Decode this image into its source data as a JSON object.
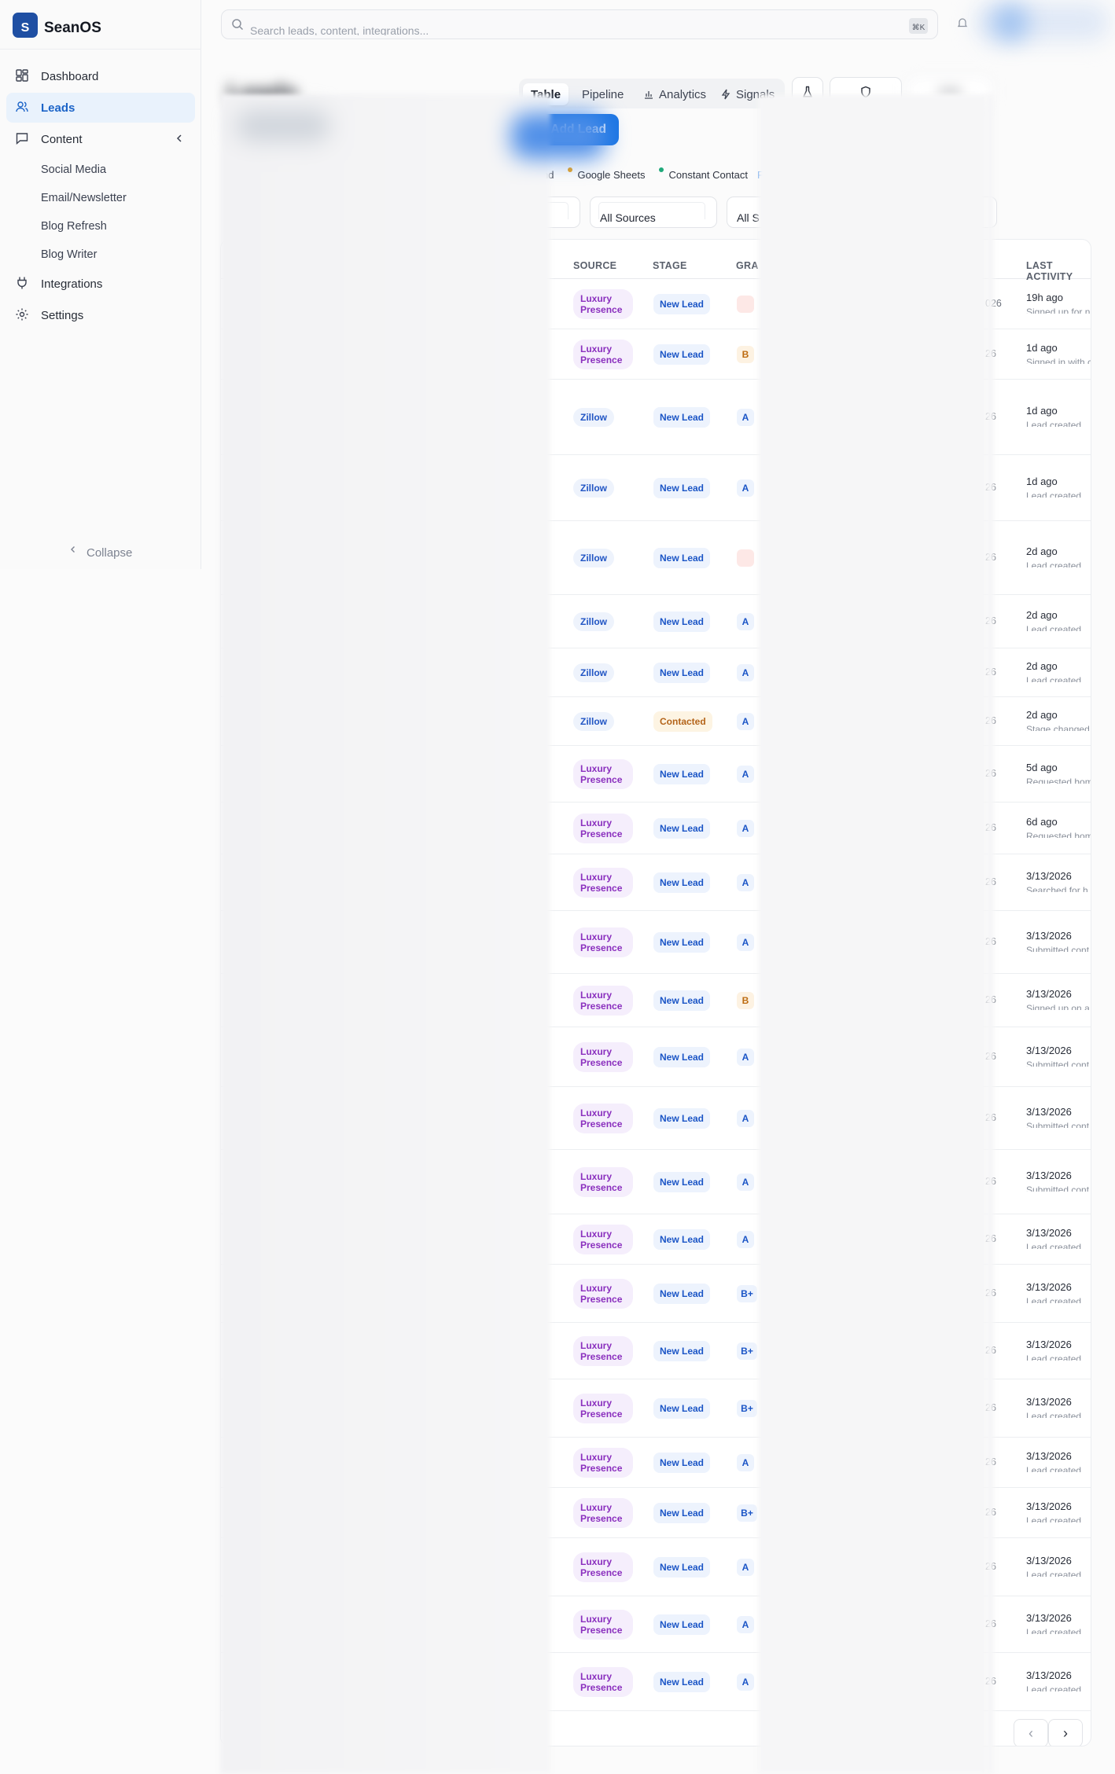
{
  "brand": {
    "mark": "S",
    "name": "SeanOS"
  },
  "nav": {
    "items": [
      {
        "label": "Dashboard"
      },
      {
        "label": "Leads"
      },
      {
        "label": "Content"
      },
      {
        "label": "Integrations"
      },
      {
        "label": "Settings"
      }
    ],
    "content_sub": [
      "Social Media",
      "Email/Newsletter",
      "Blog Refresh",
      "Blog Writer"
    ],
    "collapse_label": "Collapse"
  },
  "search": {
    "placeholder": "Search leads, content, integrations...",
    "shortcut": "⌘K"
  },
  "page": {
    "title": "Leads"
  },
  "tabs": {
    "table": "Table",
    "pipeline": "Pipeline",
    "analytics": "Analytics",
    "signals": "Signals"
  },
  "toolbar": {
    "add_lead": "Add Lead",
    "csv": "CSV"
  },
  "integrations_bar": {
    "lead_text": "nd",
    "google_sheets": "Google Sheets",
    "constant_contact": "Constant Contact",
    "link": "F"
  },
  "filters": {
    "sources": "All Sources",
    "stages": "All S"
  },
  "table": {
    "headers": {
      "source": "SOURCE",
      "stage": "STAGE",
      "grade": "GRA",
      "last_activity": "LAST ACTIVITY"
    },
    "rows": [
      {
        "source": "Luxury Presence",
        "stage": "New Lead",
        "grade": "",
        "date": "026",
        "when": "19h ago",
        "desc": "Signed up for n"
      },
      {
        "source": "Luxury Presence",
        "stage": "New Lead",
        "grade": "B",
        "date": "26",
        "when": "1d ago",
        "desc": "Signed in with c"
      },
      {
        "source": "Zillow",
        "stage": "New Lead",
        "grade": "A",
        "date": "26",
        "when": "1d ago",
        "desc": "Lead created"
      },
      {
        "source": "Zillow",
        "stage": "New Lead",
        "grade": "A",
        "date": "26",
        "when": "1d ago",
        "desc": "Lead created"
      },
      {
        "source": "Zillow",
        "stage": "New Lead",
        "grade": "",
        "date": "26",
        "when": "2d ago",
        "desc": "Lead created"
      },
      {
        "source": "Zillow",
        "stage": "New Lead",
        "grade": "A",
        "date": "26",
        "when": "2d ago",
        "desc": "Lead created"
      },
      {
        "source": "Zillow",
        "stage": "New Lead",
        "grade": "A",
        "date": "26",
        "when": "2d ago",
        "desc": "Lead created"
      },
      {
        "source": "Zillow",
        "stage": "Contacted",
        "grade": "A",
        "date": "26",
        "when": "2d ago",
        "desc": "Stage changed"
      },
      {
        "source": "Luxury Presence",
        "stage": "New Lead",
        "grade": "A",
        "date": "26",
        "when": "5d ago",
        "desc": "Requested hom"
      },
      {
        "source": "Luxury Presence",
        "stage": "New Lead",
        "grade": "A",
        "date": "26",
        "when": "6d ago",
        "desc": "Requested hom"
      },
      {
        "source": "Luxury Presence",
        "stage": "New Lead",
        "grade": "A",
        "date": "26",
        "when": "3/13/2026",
        "desc": "Searched for h"
      },
      {
        "source": "Luxury Presence",
        "stage": "New Lead",
        "grade": "A",
        "date": "26",
        "when": "3/13/2026",
        "desc": "Submitted cont"
      },
      {
        "source": "Luxury Presence",
        "stage": "New Lead",
        "grade": "B",
        "date": "26",
        "when": "3/13/2026",
        "desc": "Signed up on a"
      },
      {
        "source": "Luxury Presence",
        "stage": "New Lead",
        "grade": "A",
        "date": "26",
        "when": "3/13/2026",
        "desc": "Submitted cont"
      },
      {
        "source": "Luxury Presence",
        "stage": "New Lead",
        "grade": "A",
        "date": "26",
        "when": "3/13/2026",
        "desc": "Submitted cont"
      },
      {
        "source": "Luxury Presence",
        "stage": "New Lead",
        "grade": "A",
        "date": "26",
        "when": "3/13/2026",
        "desc": "Submitted cont"
      },
      {
        "source": "Luxury Presence",
        "stage": "New Lead",
        "grade": "A",
        "date": "26",
        "when": "3/13/2026",
        "desc": "Lead created"
      },
      {
        "source": "Luxury Presence",
        "stage": "New Lead",
        "grade": "B+",
        "date": "26",
        "when": "3/13/2026",
        "desc": "Lead created"
      },
      {
        "source": "Luxury Presence",
        "stage": "New Lead",
        "grade": "B+",
        "date": "26",
        "when": "3/13/2026",
        "desc": "Lead created"
      },
      {
        "source": "Luxury Presence",
        "stage": "New Lead",
        "grade": "B+",
        "date": "26",
        "when": "3/13/2026",
        "desc": "Lead created"
      },
      {
        "source": "Luxury Presence",
        "stage": "New Lead",
        "grade": "A",
        "date": "26",
        "when": "3/13/2026",
        "desc": "Lead created"
      },
      {
        "source": "Luxury Presence",
        "stage": "New Lead",
        "grade": "B+",
        "date": "26",
        "when": "3/13/2026",
        "desc": "Lead created"
      },
      {
        "source": "Luxury Presence",
        "stage": "New Lead",
        "grade": "A",
        "date": "26",
        "when": "3/13/2026",
        "desc": "Lead created"
      },
      {
        "source": "Luxury Presence",
        "stage": "New Lead",
        "grade": "A",
        "date": "26",
        "when": "3/13/2026",
        "desc": "Lead created"
      },
      {
        "source": "Luxury Presence",
        "stage": "New Lead",
        "grade": "A",
        "date": "26",
        "when": "3/13/2026",
        "desc": "Lead created"
      }
    ]
  },
  "pagination": {
    "prev": "‹",
    "next": "›"
  },
  "colors": {
    "accent": "#1a75e4",
    "brand": "#1f4fa3",
    "luxury": "#8a2fbe",
    "zillow": "#2155c4",
    "contacted": "#b4641a"
  }
}
